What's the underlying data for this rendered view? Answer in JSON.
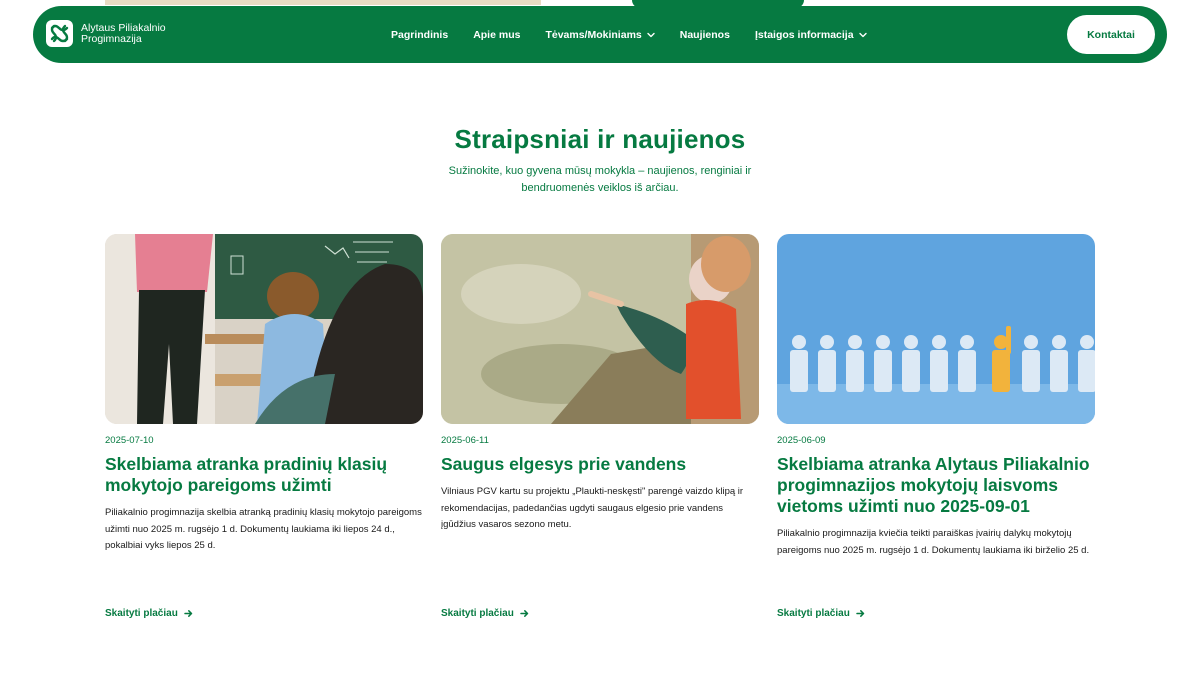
{
  "header": {
    "logo_line1": "Alytaus Piliakalnio",
    "logo_line2": "Progimnazija",
    "nav": [
      {
        "label": "Pagrindinis",
        "has_dropdown": false
      },
      {
        "label": "Apie mus",
        "has_dropdown": false
      },
      {
        "label": "Tėvams/Mokiniams",
        "has_dropdown": true
      },
      {
        "label": "Naujienos",
        "has_dropdown": false
      },
      {
        "label": "Įstaigos informacija",
        "has_dropdown": true
      }
    ],
    "contact_label": "Kontaktai"
  },
  "section": {
    "title": "Straipsniai ir naujienos",
    "subtitle": "Sužinokite, kuo gyvena mūsų mokykla – naujienos, renginiai ir bendruomenės veiklos iš arčiau."
  },
  "cards": [
    {
      "date": "2025-07-10",
      "title": "Skelbiama atranka pradinių klasių mokytojo pareigoms užimti",
      "text": "Piliakalnio progimnazija skelbia atranką pradinių klasių mokytojo pareigoms užimti nuo 2025 m. rugsėjo 1 d. Dokumentų laukiama iki liepos 24 d., pokalbiai vyks liepos 25 d.",
      "link": "Skaityti plačiau",
      "image": "classroom-photo"
    },
    {
      "date": "2025-06-11",
      "title": "Saugus elgesys prie vandens",
      "text": "Vilniaus PGV kartu su projektu „Plaukti-neskęsti\" parengė vaizdo klipą ir rekomendacijas, padedančias ugdyti saugaus elgesio prie vandens įgūdžius vasaros sezono metu.",
      "link": "Skaityti plačiau",
      "image": "water-photo"
    },
    {
      "date": "2025-06-09",
      "title": "Skelbiama atranka Alytaus Piliakalnio progimnazijos mokytojų laisvoms vietoms užimti nuo 2025-09-01",
      "text": "Piliakalnio progimnazija kviečia teikti paraiškas įvairių dalykų mokytojų pareigoms nuo 2025 m. rugsėjo 1 d. Dokumentų laukiama iki birželio 25 d.",
      "link": "Skaityti plačiau",
      "image": "figures-photo"
    }
  ],
  "colors": {
    "brand_green": "#067a41",
    "background": "#ffffff",
    "text": "#1a1a1a"
  }
}
